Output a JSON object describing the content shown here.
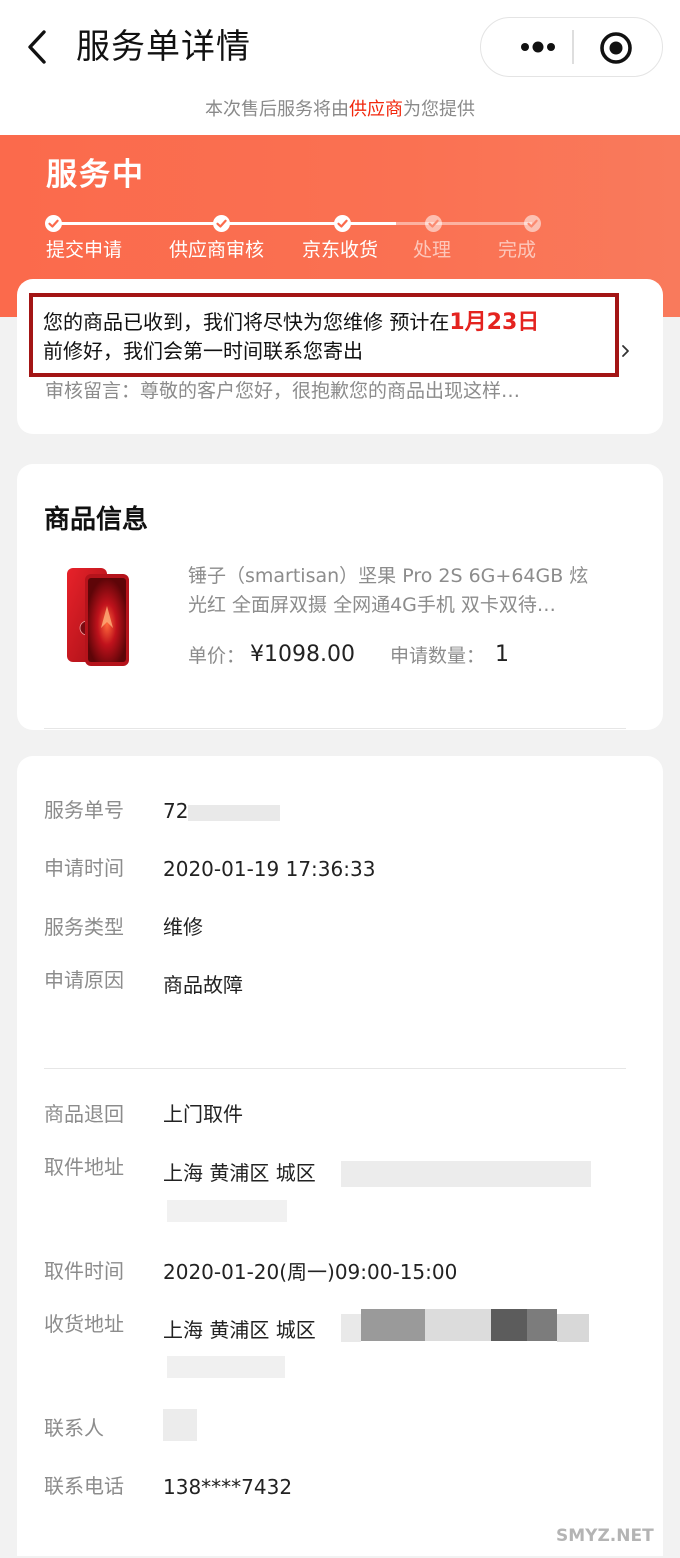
{
  "header": {
    "title": "服务单详情"
  },
  "notice": {
    "prefix": "本次售后服务将由",
    "highlight": "供应商",
    "suffix": "为您提供"
  },
  "status": {
    "title": "服务中",
    "steps": [
      {
        "label": "提交申请",
        "done": true
      },
      {
        "label": "供应商审核",
        "done": true
      },
      {
        "label": "京东收货",
        "done": true
      },
      {
        "label": "处理",
        "done": false
      },
      {
        "label": "完成",
        "done": false
      }
    ],
    "message_pre": "您的商品已收到，我们将尽快为您维修 预计在",
    "message_date": "1月23日",
    "message_post": "前修好，我们会第一时间联系您寄出",
    "review_note": "审核留言：尊敬的客户您好，很抱歉您的商品出现这样…"
  },
  "product": {
    "section_title": "商品信息",
    "name_line1": "锤子（smartisan）坚果 Pro 2S 6G+64GB 炫",
    "name_line2": "光红 全面屏双摄 全网通4G手机 双卡双待…",
    "price_label": "单价：",
    "price": "¥1098.00",
    "qty_label": "申请数量：",
    "qty": "1"
  },
  "info": {
    "order_no_label": "服务单号",
    "order_no": "72",
    "apply_time_label": "申请时间",
    "apply_time": "2020-01-19 17:36:33",
    "service_type_label": "服务类型",
    "service_type": "维修",
    "reason_label": "申请原因",
    "reason": "商品故障",
    "return_label": "商品退回",
    "return_method": "上门取件",
    "pickup_addr_label": "取件地址",
    "pickup_addr": "上海 黄浦区 城区",
    "pickup_time_label": "取件时间",
    "pickup_time": "2020-01-20(周一)09:00-15:00",
    "recv_addr_label": "收货地址",
    "recv_addr": "上海 黄浦区 城区",
    "contact_label": "联系人",
    "phone_label": "联系电话",
    "phone": "138****7432"
  },
  "watermark": "SMYZ.NET",
  "colors": {
    "banner": "#fb6a4c",
    "accent": "#f2270c",
    "box": "#a31515"
  }
}
